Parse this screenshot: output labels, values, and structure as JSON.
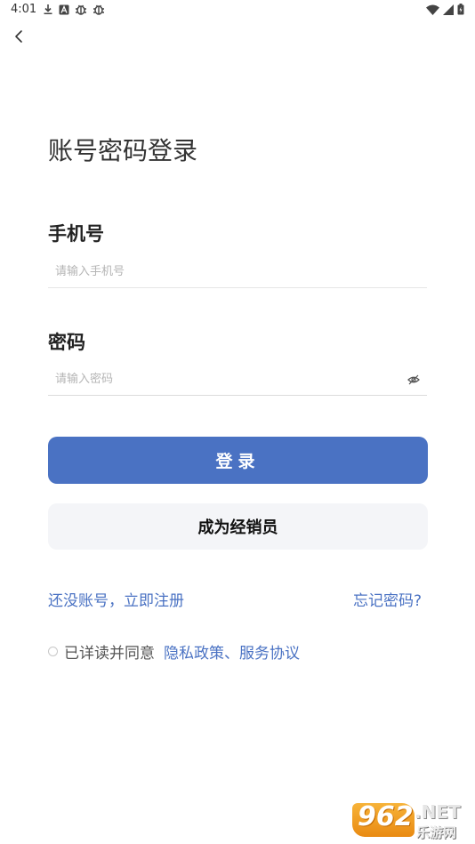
{
  "status_bar": {
    "time": "4:01",
    "left_icons": [
      "download-icon",
      "a-icon",
      "bug-icon",
      "bug-icon"
    ],
    "right_icons": [
      "wifi-icon",
      "signal-icon",
      "battery-icon"
    ]
  },
  "header": {
    "back_icon": "chevron-left-icon"
  },
  "title": "账号密码登录",
  "phone": {
    "label": "手机号",
    "placeholder": "请输入手机号",
    "value": ""
  },
  "password": {
    "label": "密码",
    "placeholder": "请输入密码",
    "value": "",
    "toggle_icon": "eye-off-icon"
  },
  "buttons": {
    "login": "登录",
    "become_dealer": "成为经销员"
  },
  "links": {
    "register": "还没账号，立即注册",
    "forgot_password": "忘记密码?"
  },
  "agreement": {
    "checked": false,
    "text": "已详读并同意",
    "policy": "隐私政策、服务协议"
  },
  "watermark": {
    "number": "962",
    "suffix": ".NET",
    "site": "乐游网"
  },
  "colors": {
    "primary": "#4a72c3",
    "secondary_button_bg": "#f4f5f8",
    "text": "#333333",
    "placeholder": "#b5b5b5"
  }
}
